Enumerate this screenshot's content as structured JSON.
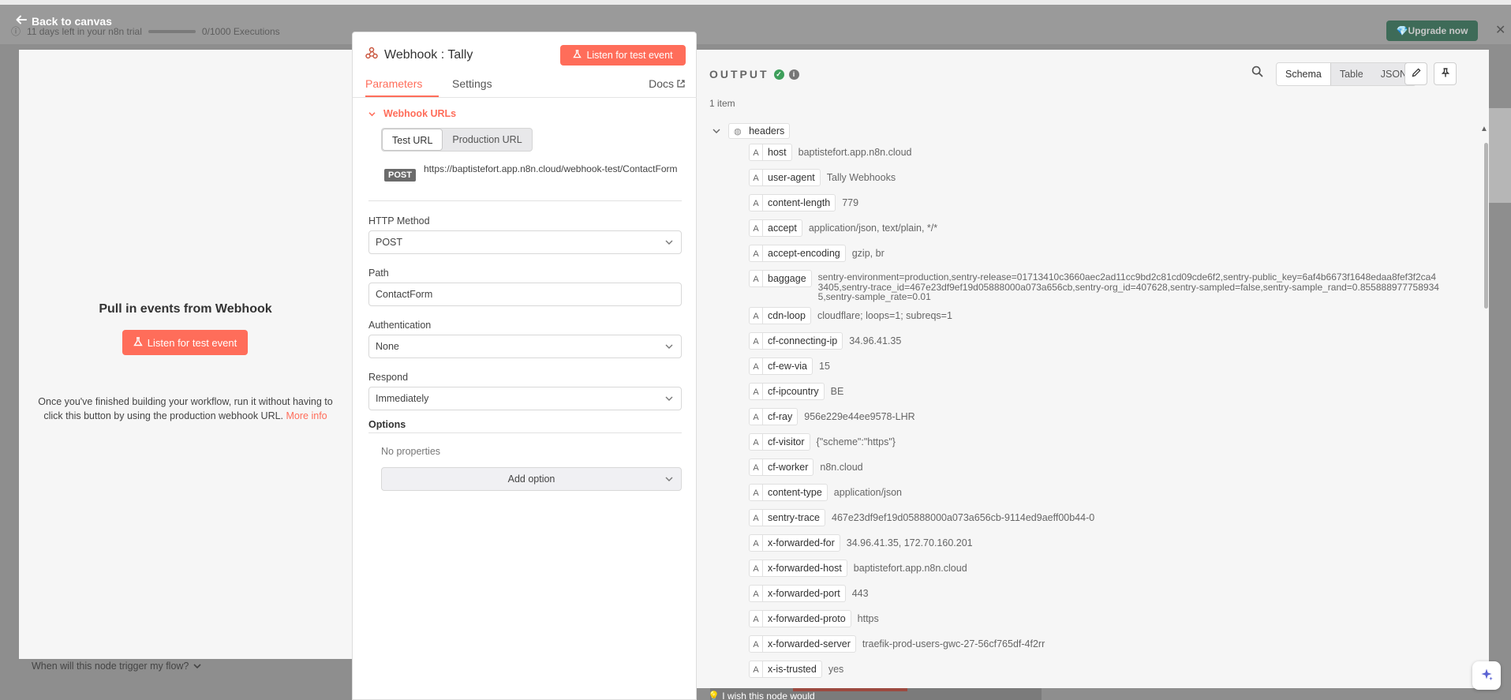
{
  "background": {
    "trial_text": "11 days left in your n8n trial",
    "executions": "0/1000 Executions",
    "upgrade_label": "Upgrade now",
    "footer_hint": "I wish this node would"
  },
  "nav": {
    "back_label": "Back to canvas"
  },
  "left_panel": {
    "title": "Pull in events from Webhook",
    "listen_label": "Listen for test event",
    "description": "Once you've finished building your workflow, run it without having to click this button by using the production webhook URL.",
    "more_info": "More info",
    "trigger_question": "When will this node trigger my flow?"
  },
  "node": {
    "title": "Webhook : Tally",
    "listen_label": "Listen for test event",
    "tabs": {
      "parameters": "Parameters",
      "settings": "Settings",
      "docs": "Docs"
    },
    "webhook_urls_label": "Webhook URLs",
    "url_tabs": {
      "test": "Test URL",
      "production": "Production URL"
    },
    "method_badge": "POST",
    "url": "https://baptistefort.app.n8n.cloud/webhook-test/ContactForm",
    "http_method": {
      "label": "HTTP Method",
      "value": "POST"
    },
    "path": {
      "label": "Path",
      "value": "ContactForm"
    },
    "authentication": {
      "label": "Authentication",
      "value": "None"
    },
    "respond": {
      "label": "Respond",
      "value": "Immediately"
    },
    "options": {
      "label": "Options",
      "empty": "No properties",
      "add_label": "Add option"
    }
  },
  "output": {
    "title": "OUTPUT",
    "items_count": "1 item",
    "views": {
      "schema": "Schema",
      "table": "Table",
      "json": "JSON"
    },
    "root_key": "headers",
    "rows": [
      {
        "key": "host",
        "value": "baptistefort.app.n8n.cloud"
      },
      {
        "key": "user-agent",
        "value": "Tally Webhooks"
      },
      {
        "key": "content-length",
        "value": "779"
      },
      {
        "key": "accept",
        "value": "application/json, text/plain, */*"
      },
      {
        "key": "accept-encoding",
        "value": "gzip, br"
      },
      {
        "key": "baggage",
        "value": "sentry-environment=production,sentry-release=01713410c3660aec2ad11cc9bd2c81cd09cde6f2,sentry-public_key=6af4b6673f1648edaa8fef3f2ca43405,sentry-trace_id=467e23df9ef19d05888000a073a656cb,sentry-org_id=407628,sentry-sampled=false,sentry-sample_rand=0.8558889777589345,sentry-sample_rate=0.01"
      },
      {
        "key": "cdn-loop",
        "value": "cloudflare; loops=1; subreqs=1"
      },
      {
        "key": "cf-connecting-ip",
        "value": "34.96.41.35"
      },
      {
        "key": "cf-ew-via",
        "value": "15"
      },
      {
        "key": "cf-ipcountry",
        "value": "BE"
      },
      {
        "key": "cf-ray",
        "value": "956e229e44ee9578-LHR"
      },
      {
        "key": "cf-visitor",
        "value": "{\"scheme\":\"https\"}"
      },
      {
        "key": "cf-worker",
        "value": "n8n.cloud"
      },
      {
        "key": "content-type",
        "value": "application/json"
      },
      {
        "key": "sentry-trace",
        "value": "467e23df9ef19d05888000a073a656cb-9114ed9aeff00b44-0"
      },
      {
        "key": "x-forwarded-for",
        "value": "34.96.41.35, 172.70.160.201"
      },
      {
        "key": "x-forwarded-host",
        "value": "baptistefort.app.n8n.cloud"
      },
      {
        "key": "x-forwarded-port",
        "value": "443"
      },
      {
        "key": "x-forwarded-proto",
        "value": "https"
      },
      {
        "key": "x-forwarded-server",
        "value": "traefik-prod-users-gwc-27-56cf765df-4f2rr"
      },
      {
        "key": "x-is-trusted",
        "value": "yes"
      }
    ]
  },
  "colors": {
    "accent": "#ff6d5a",
    "success": "#3e9f5b",
    "upgrade": "#3e6b58"
  },
  "icons": [
    "arrow-left-icon",
    "flask-icon",
    "webhook-icon",
    "external-link-icon",
    "chevron-down-icon",
    "check-circle-icon",
    "info-icon",
    "search-icon",
    "pencil-icon",
    "pin-icon",
    "globe-icon",
    "sparkle-icon"
  ]
}
